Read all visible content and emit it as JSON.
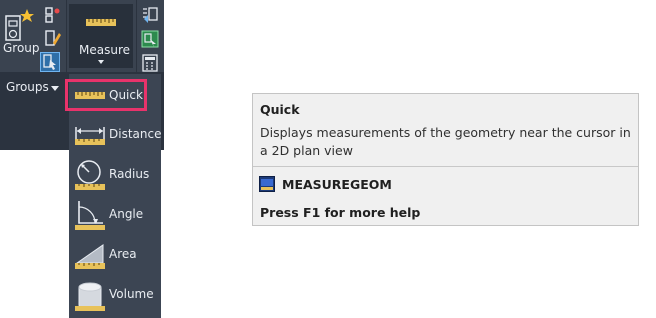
{
  "ribbon": {
    "group_label": "Group",
    "measure_label": "Measure",
    "groups_label": "Groups"
  },
  "dropdown": {
    "items": [
      {
        "label": "Quick",
        "icon": "ruler-icon"
      },
      {
        "label": "Distance",
        "icon": "distance-icon"
      },
      {
        "label": "Radius",
        "icon": "radius-icon"
      },
      {
        "label": "Angle",
        "icon": "angle-icon"
      },
      {
        "label": "Area",
        "icon": "area-icon"
      },
      {
        "label": "Volume",
        "icon": "volume-icon"
      }
    ]
  },
  "tooltip": {
    "title": "Quick",
    "description": "Displays measurements of the geometry near the cursor in a 2D plan view",
    "command": "MEASUREGEOM",
    "help": "Press F1 for more help"
  },
  "colors": {
    "ribbon_bg": "#3a4350",
    "highlight": "#e8336b",
    "ruler": "#e8c25a"
  }
}
